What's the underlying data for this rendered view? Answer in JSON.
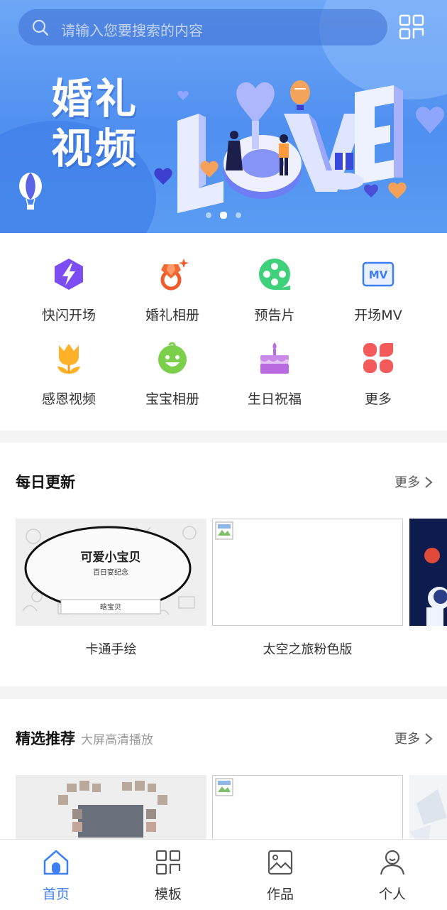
{
  "search": {
    "placeholder": "请输入您要搜索的内容"
  },
  "banner": {
    "title_line1": "婚礼",
    "title_line2": "视频",
    "active_dot": 1,
    "dot_count": 3
  },
  "categories": [
    {
      "label": "快闪开场",
      "icon": "lightning-icon"
    },
    {
      "label": "婚礼相册",
      "icon": "ring-icon"
    },
    {
      "label": "预告片",
      "icon": "film-reel-icon"
    },
    {
      "label": "开场MV",
      "icon": "mv-icon"
    },
    {
      "label": "感恩视频",
      "icon": "tulip-icon"
    },
    {
      "label": "宝宝相册",
      "icon": "baby-icon"
    },
    {
      "label": "生日祝福",
      "icon": "cake-icon"
    },
    {
      "label": "更多",
      "icon": "more-apps-icon"
    }
  ],
  "daily": {
    "title": "每日更新",
    "more": "更多",
    "cards": [
      {
        "caption": "卡通手绘",
        "thumb_title": "可爱小宝贝",
        "thumb_sub": "百日宴纪念",
        "thumb_tag": "晗宝贝"
      },
      {
        "caption": "太空之旅粉色版"
      }
    ]
  },
  "featured": {
    "title": "精选推荐",
    "subtitle": "大屏高清播放",
    "more": "更多"
  },
  "tabs": [
    {
      "label": "首页",
      "icon": "home-icon",
      "active": true
    },
    {
      "label": "模板",
      "icon": "template-grid-icon",
      "active": false
    },
    {
      "label": "作品",
      "icon": "image-icon",
      "active": false
    },
    {
      "label": "个人",
      "icon": "user-icon",
      "active": false
    }
  ],
  "colors": {
    "accent": "#3d7ff3",
    "banner_blue": "#4f8ff0"
  }
}
